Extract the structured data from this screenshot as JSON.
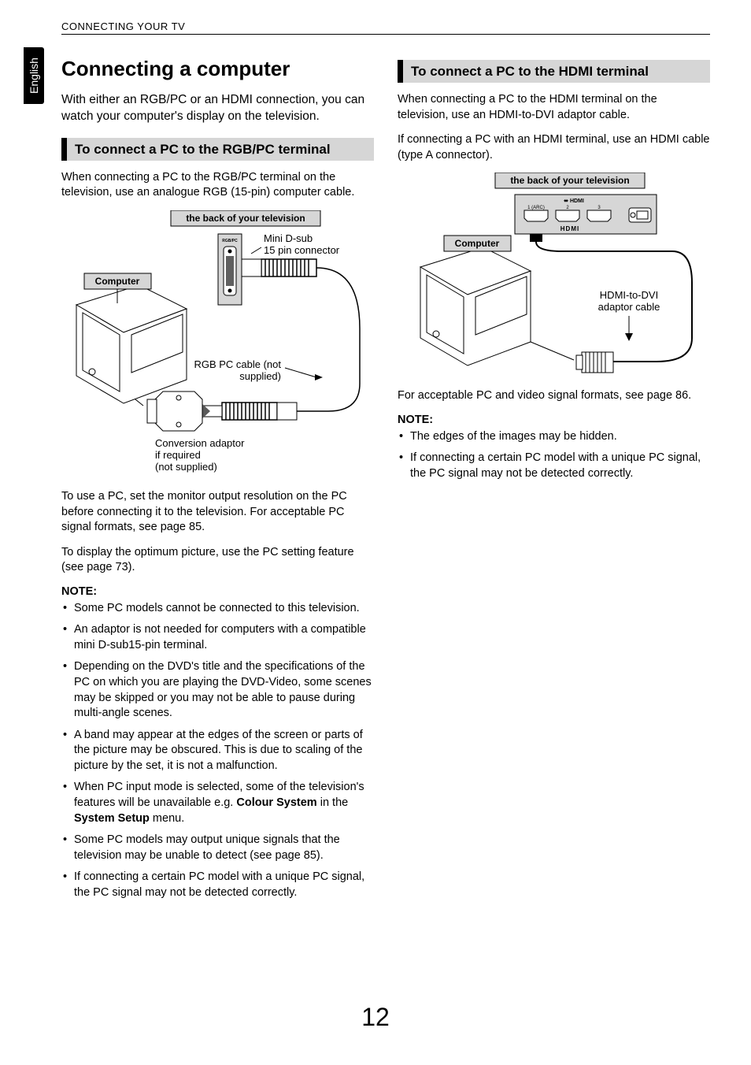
{
  "running_header": "CONNECTING YOUR TV",
  "side_tab": "English",
  "main_heading": "Connecting a computer",
  "intro": "With either an RGB/PC or an HDMI connection, you can watch your computer's display on the television.",
  "page_number": "12",
  "left": {
    "subhead": "To connect a PC to the RGB/PC terminal",
    "p1": "When connecting a PC to the RGB/PC terminal on the television, use an analogue RGB (15-pin) computer cable.",
    "dia_back_label": "the back of your television",
    "dia_computer_label": "Computer",
    "dia_connector": "Mini D-sub 15 pin connector",
    "dia_cable": "RGB PC cable (not supplied)",
    "dia_adaptor_l1": "Conversion adaptor",
    "dia_adaptor_l2": "if required",
    "dia_adaptor_l3": "(not supplied)",
    "p2": "To use a PC, set the monitor output resolution on the PC before connecting it to the television. For acceptable PC signal formats, see page 85.",
    "p3": "To display the optimum picture, use the PC setting feature (see page 73).",
    "note_head": "NOTE:",
    "notes": [
      "Some PC models cannot be connected to this television.",
      "An adaptor is not needed for computers with a compatible mini D-sub15-pin terminal.",
      "Depending on the DVD's title and the specifications of the PC on which you are playing the DVD-Video, some scenes may be skipped or you may not be able to pause during multi-angle scenes.",
      "A band may appear at the edges of the screen or parts of the picture may be obscured. This is due to scaling of the picture by the set, it is not a malfunction.",
      "When PC input mode is selected, some of the television's features will be unavailable e.g. <b>Colour System</b> in the <b>System Setup</b> menu.",
      "Some PC models may output unique signals that the television may be unable to detect (see page 85).",
      "If connecting a certain PC model with a unique PC signal, the PC signal may not be detected correctly."
    ]
  },
  "right": {
    "subhead": "To connect a PC to the HDMI terminal",
    "p1": "When connecting a PC to the HDMI terminal on the television, use an HDMI-to-DVI adaptor cable.",
    "p2": "If connecting a PC with an HDMI terminal, use an HDMI cable (type A connector).",
    "dia_back_label": "the back of your television",
    "dia_computer_label": "Computer",
    "dia_cable": "HDMI-to-DVI adaptor cable",
    "p3": "For acceptable PC and video signal formats, see page 86.",
    "note_head": "NOTE:",
    "notes": [
      "The edges of the images may be hidden.",
      "If connecting a certain PC model with a unique PC signal, the PC signal may not be detected correctly."
    ]
  }
}
